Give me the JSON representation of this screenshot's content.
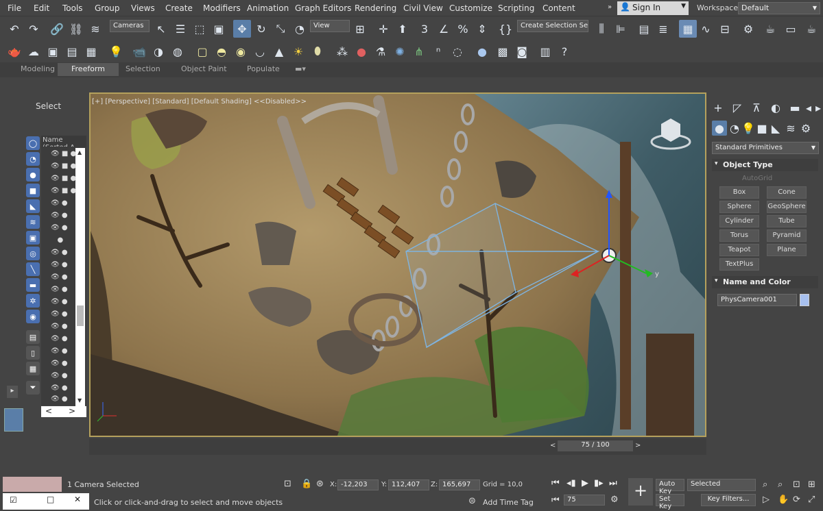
{
  "menu": [
    "File",
    "Edit",
    "Tools",
    "Group",
    "Views",
    "Create",
    "Modifiers",
    "Animation",
    "Graph Editors",
    "Rendering",
    "Civil View",
    "Customize",
    "Scripting",
    "Content"
  ],
  "signin": "Sign In",
  "workspaces_label": "Workspaces:",
  "workspaces_value": "Default",
  "toolbar": {
    "cameras_dd": "Cameras",
    "view_dd": "View",
    "selection_set_dd": "Create Selection Se"
  },
  "ribbon_tabs": [
    "Modeling",
    "Freeform",
    "Selection",
    "Object Paint",
    "Populate"
  ],
  "scene_explorer": {
    "title": "Select",
    "column": "Name (Sorted A"
  },
  "viewport": {
    "label": "[+] [Perspective] [Standard] [Default Shading]  <<Disabled>>",
    "axis_y": "y"
  },
  "command_panel": {
    "category": "Standard Primitives",
    "object_type_title": "Object Type",
    "autogrid": "AutoGrid",
    "buttons": [
      "Box",
      "Cone",
      "Sphere",
      "GeoSphere",
      "Cylinder",
      "Tube",
      "Torus",
      "Pyramid",
      "Teapot",
      "Plane",
      "TextPlus"
    ],
    "name_color_title": "Name and Color",
    "name_value": "PhysCamera001",
    "color": "#a7c0ee"
  },
  "timeslider": {
    "value": "75 / 100"
  },
  "status": {
    "selected": "1 Camera Selected",
    "hint": "Click or click-and-drag to select and move objects",
    "x_label": "X:",
    "x_val": "-12,203",
    "y_label": "Y:",
    "y_val": "112,407",
    "z_label": "Z:",
    "z_val": "165,697",
    "grid": "Grid = 10,0",
    "add_time_tag": "Add Time Tag",
    "auto_key": "Auto Key",
    "selected_dd": "Selected",
    "set_key": "Set Key",
    "key_filters": "Key Filters...",
    "frame": "75"
  }
}
